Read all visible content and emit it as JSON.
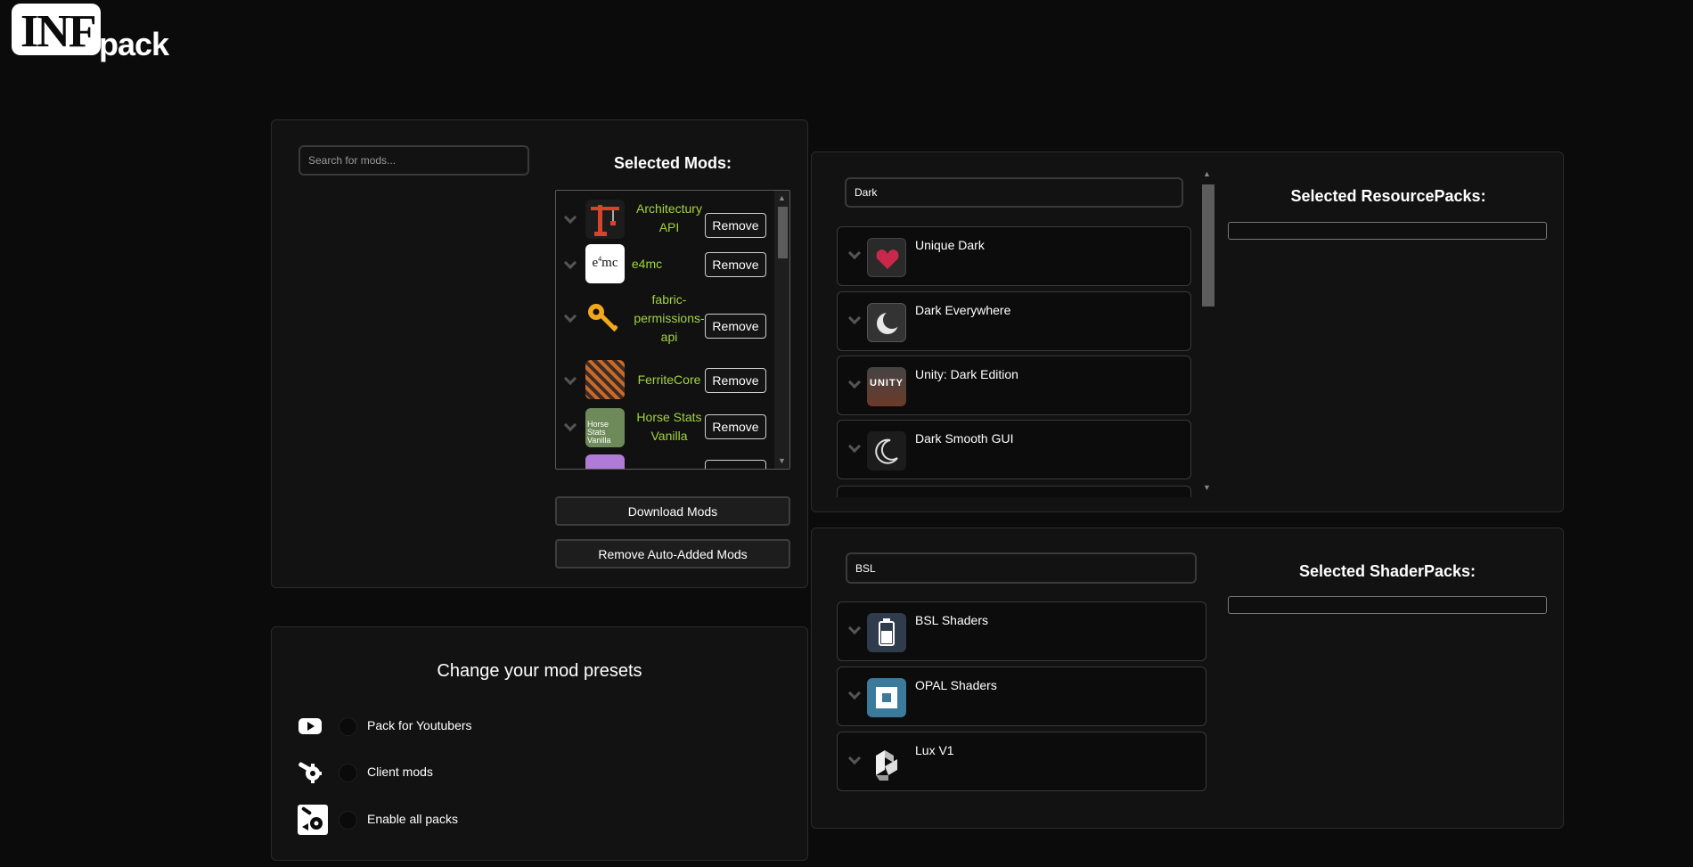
{
  "logo": {
    "text_a": "INF",
    "text_b": "pack"
  },
  "mods_panel": {
    "search": {
      "placeholder": "Search for mods...",
      "value": ""
    },
    "selected_title": "Selected Mods:",
    "selected_mods": [
      {
        "name": "Architectury API",
        "icon": "crane-icon",
        "remove": "Remove"
      },
      {
        "name": "e4mc",
        "icon": "e4mc-logo-icon",
        "remove": "Remove"
      },
      {
        "name": "fabric-permissions-api",
        "icon": "key-icon",
        "remove": "Remove"
      },
      {
        "name": "FerriteCore",
        "icon": "ferrite-pattern-icon",
        "remove": "Remove"
      },
      {
        "name": "Horse Stats Vanilla",
        "icon": "horse-stats-icon",
        "remove": "Remove"
      }
    ],
    "download_button": "Download Mods",
    "remove_auto_button": "Remove Auto-Added Mods"
  },
  "presets_panel": {
    "title": "Change your mod presets",
    "options": [
      {
        "label": "Pack for Youtubers",
        "icon": "youtube-icon"
      },
      {
        "label": "Client mods",
        "icon": "wrench-gear-icon"
      },
      {
        "label": "Enable all packs",
        "icon": "all-packs-icon"
      }
    ]
  },
  "resource_panel": {
    "search": {
      "value": "Dark"
    },
    "selected_title": "Selected ResourcePacks:",
    "results": [
      {
        "name": "Unique Dark",
        "icon": "pixel-heart-icon"
      },
      {
        "name": "Dark Everywhere",
        "icon": "crescent-moon-icon"
      },
      {
        "name": "Unity: Dark Edition",
        "icon": "unity-logo-icon"
      },
      {
        "name": "Dark Smooth GUI",
        "icon": "moon-outline-icon"
      }
    ]
  },
  "shader_panel": {
    "search": {
      "value": "BSL"
    },
    "selected_title": "Selected ShaderPacks:",
    "results": [
      {
        "name": "BSL Shaders",
        "icon": "bsl-bottle-icon"
      },
      {
        "name": "OPAL Shaders",
        "icon": "opal-square-icon"
      },
      {
        "name": "Lux V1",
        "icon": "lux-cube-icon"
      }
    ]
  },
  "colors": {
    "background": "#0b0b0b",
    "panel": "#121212",
    "mod_name": "#a3d43b",
    "border": "#3a3a3a"
  }
}
